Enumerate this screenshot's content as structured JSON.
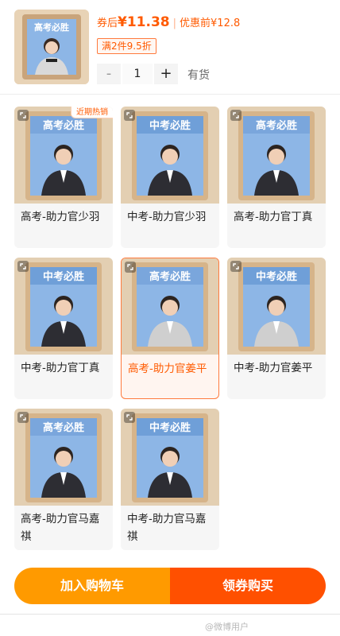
{
  "header": {
    "after_coupon_label": "券后",
    "after_coupon_price": "¥11.38",
    "separator": "|",
    "before_coupon_label": "优惠前",
    "before_coupon_price": "¥12.8",
    "promo_tag": "满2件9.5折",
    "quantity": "1",
    "minus": "-",
    "plus": "+",
    "stock": "有货"
  },
  "variants": [
    {
      "label": "高考-助力官少羽",
      "frame_text": "高考必胜",
      "hot": "近期热销",
      "selected": false
    },
    {
      "label": "中考-助力官少羽",
      "frame_text": "中考必胜",
      "hot": "",
      "selected": false
    },
    {
      "label": "高考-助力官丁真",
      "frame_text": "高考必胜",
      "hot": "",
      "selected": false
    },
    {
      "label": "中考-助力官丁真",
      "frame_text": "中考必胜",
      "hot": "",
      "selected": false
    },
    {
      "label": "高考-助力官姜平",
      "frame_text": "高考必胜",
      "hot": "",
      "selected": true
    },
    {
      "label": "中考-助力官姜平",
      "frame_text": "中考必胜",
      "hot": "",
      "selected": false
    },
    {
      "label": "高考-助力官马嘉祺",
      "frame_text": "高考必胜",
      "hot": "",
      "selected": false
    },
    {
      "label": "中考-助力官马嘉祺",
      "frame_text": "中考必胜",
      "hot": "",
      "selected": false
    }
  ],
  "actions": {
    "add_to_cart": "加入购物车",
    "coupon_buy": "领券购买"
  },
  "watermark": "@微博用户",
  "colors": {
    "accent": "#ff5a00",
    "cart": "#ff9a00",
    "buy": "#ff5000",
    "frame_blue": "#8db6e6",
    "frame_wood": "#d6b48a"
  }
}
